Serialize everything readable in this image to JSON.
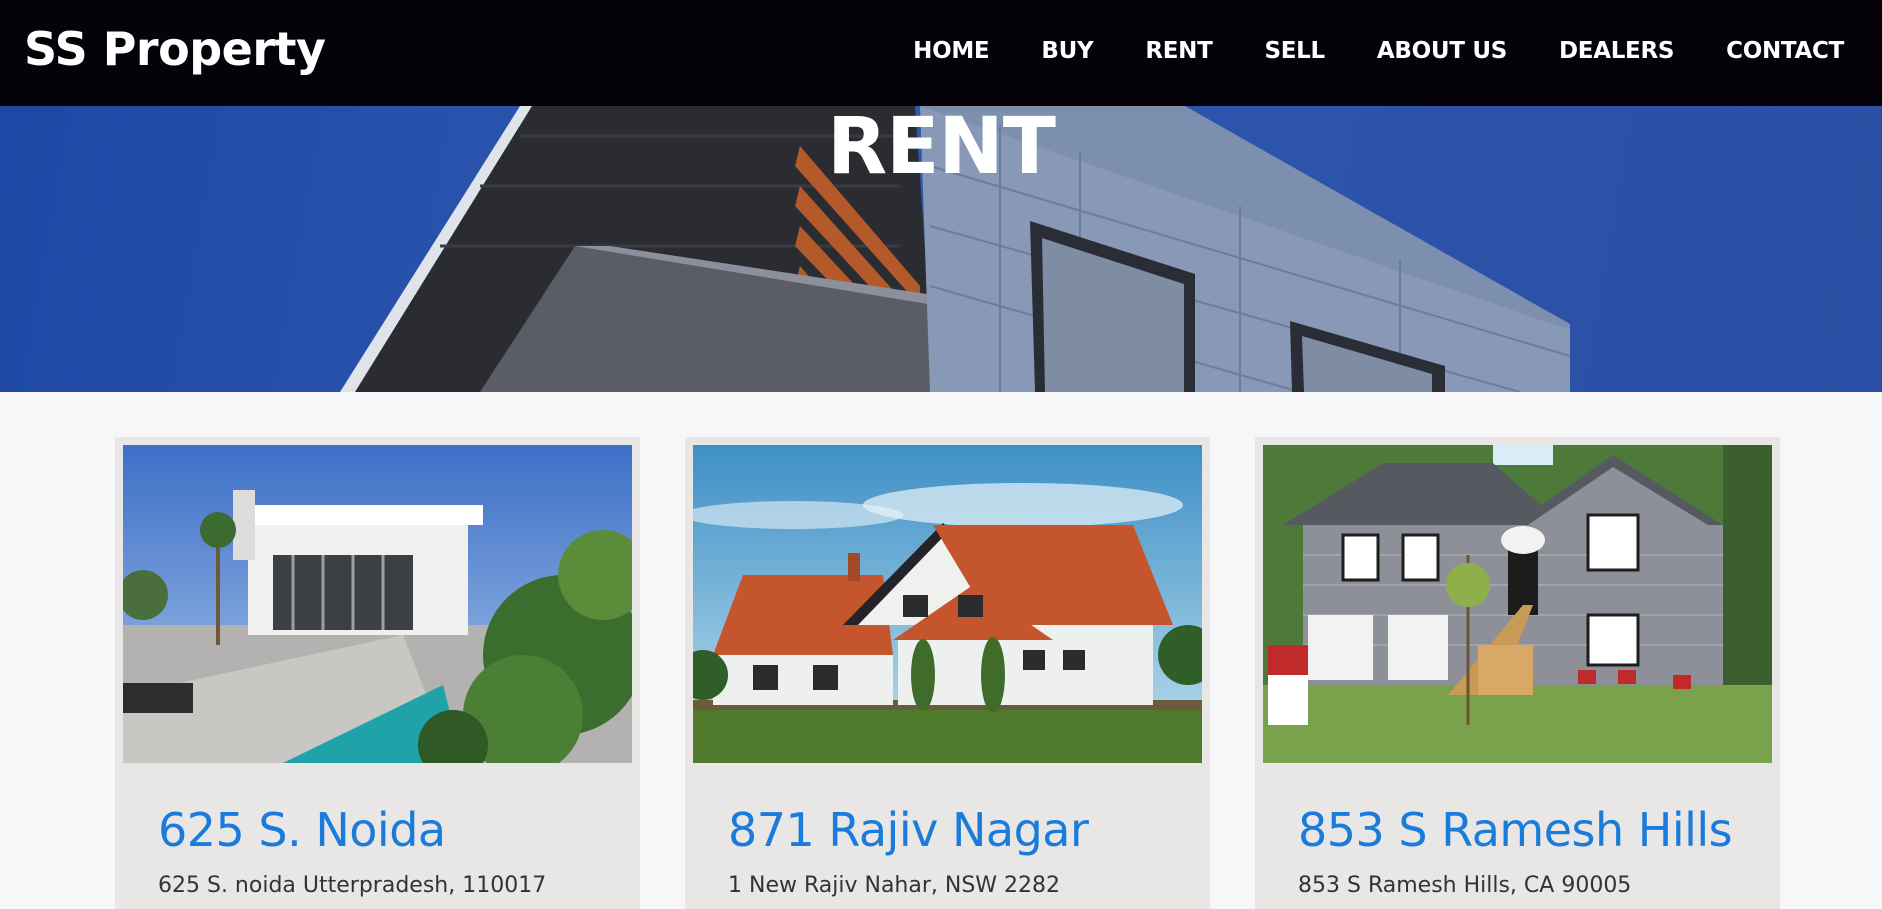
{
  "brand": "SS Property",
  "nav": {
    "items": [
      {
        "label": "HOME"
      },
      {
        "label": "BUY"
      },
      {
        "label": "RENT"
      },
      {
        "label": "SELL"
      },
      {
        "label": "ABOUT US"
      },
      {
        "label": "DEALERS"
      },
      {
        "label": "CONTACT"
      }
    ]
  },
  "hero": {
    "title": "RENT"
  },
  "cards": [
    {
      "title": "625 S. Noida",
      "address": "625 S. noida Utterpradesh, 110017"
    },
    {
      "title": "871 Rajiv Nagar",
      "address": "1 New Rajiv Nahar, NSW 2282"
    },
    {
      "title": "853 S Ramesh Hills",
      "address": "853 S Ramesh Hills, CA 90005"
    }
  ],
  "colors": {
    "navbar": "#060209",
    "accent": "#1b7bdb",
    "hero": "#2a4fa4",
    "card": "#e9e6e6"
  }
}
